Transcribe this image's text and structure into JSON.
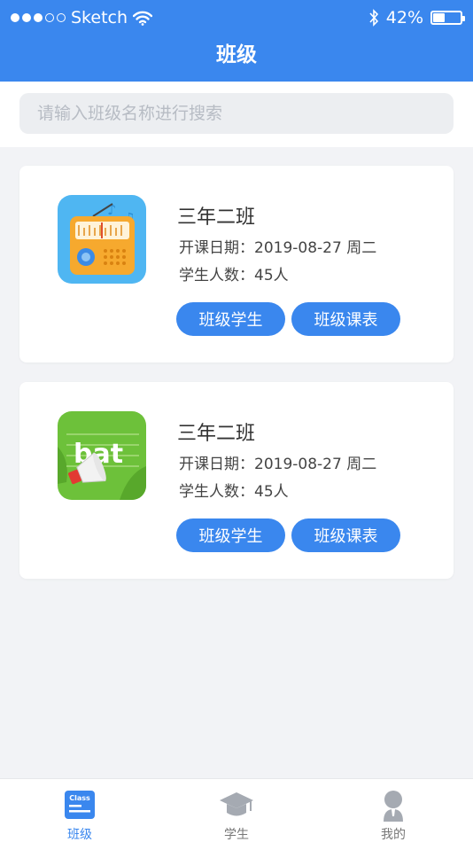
{
  "status_bar": {
    "carrier": "Sketch",
    "battery": "42%",
    "battery_level": 0.42
  },
  "header": {
    "title": "班级"
  },
  "search": {
    "placeholder": "请输入班级名称进行搜索"
  },
  "classes": [
    {
      "name": "三年二班",
      "date": "开课日期：2019-08-27 周二",
      "count": "学生人数：45人",
      "btn_students": "班级学生",
      "btn_schedule": "班级课表",
      "icon": "radio-icon"
    },
    {
      "name": "三年二班",
      "date": "开课日期：2019-08-27 周二",
      "count": "学生人数：45人",
      "btn_students": "班级学生",
      "btn_schedule": "班级课表",
      "icon": "bat-word-icon",
      "icon_text": "bat"
    }
  ],
  "tabbar": {
    "items": [
      {
        "label": "班级",
        "icon": "class-icon",
        "icon_text": "Class",
        "active": true
      },
      {
        "label": "学生",
        "icon": "graduation-cap-icon",
        "active": false
      },
      {
        "label": "我的",
        "icon": "profile-icon",
        "active": false
      }
    ]
  },
  "colors": {
    "primary": "#3a87ee",
    "background": "#f2f3f6"
  }
}
